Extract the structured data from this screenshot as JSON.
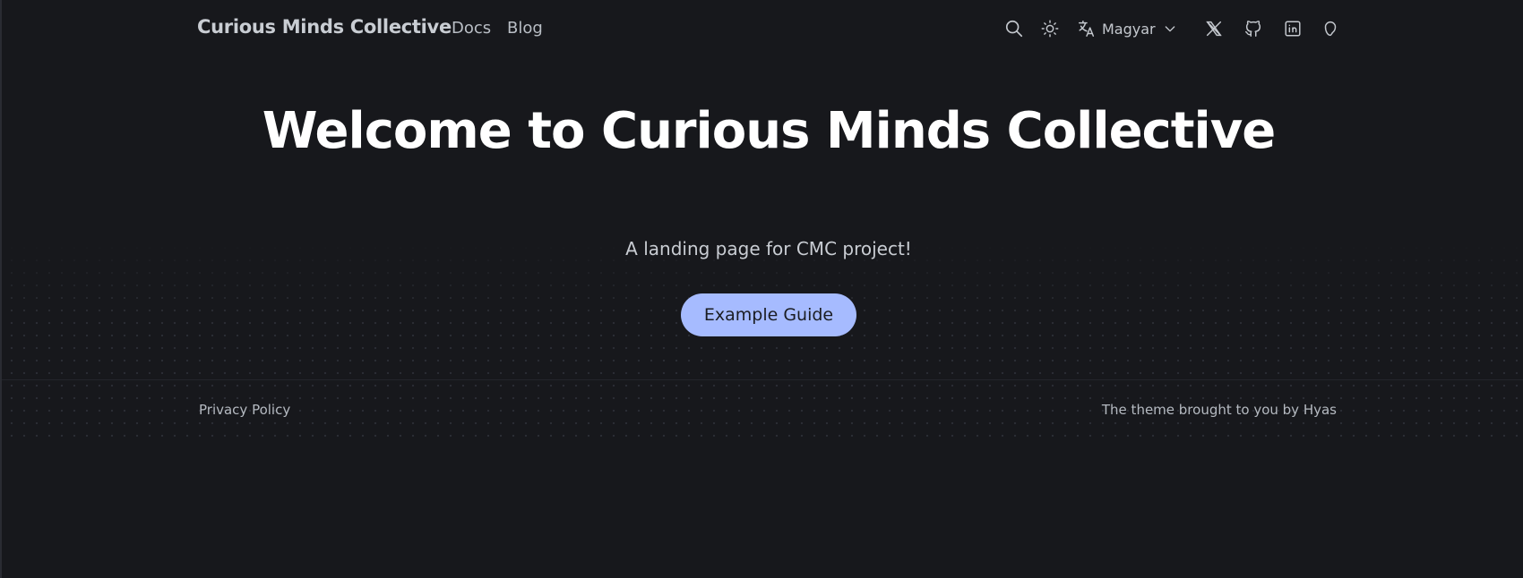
{
  "header": {
    "brand": "Curious Minds Collective",
    "nav": [
      {
        "label": "Docs"
      },
      {
        "label": "Blog"
      }
    ],
    "icons": {
      "search": "search-icon",
      "theme": "sun-icon",
      "translate": "translate-icon",
      "x": "x-icon",
      "github": "github-icon",
      "linkedin": "linkedin-icon",
      "mastodon": "mastodon-icon"
    },
    "language": {
      "selected": "Magyar"
    }
  },
  "hero": {
    "title": "Welcome to Curious Minds Collective",
    "subtitle": "A landing page for CMC project!",
    "cta_label": "Example Guide"
  },
  "footer": {
    "privacy": "Privacy Policy",
    "credit_prefix": "The theme brought to you by ",
    "credit_link": "Hyas"
  },
  "colors": {
    "background": "#17181c",
    "accent": "#a6bbff",
    "text": "#ffffff"
  }
}
